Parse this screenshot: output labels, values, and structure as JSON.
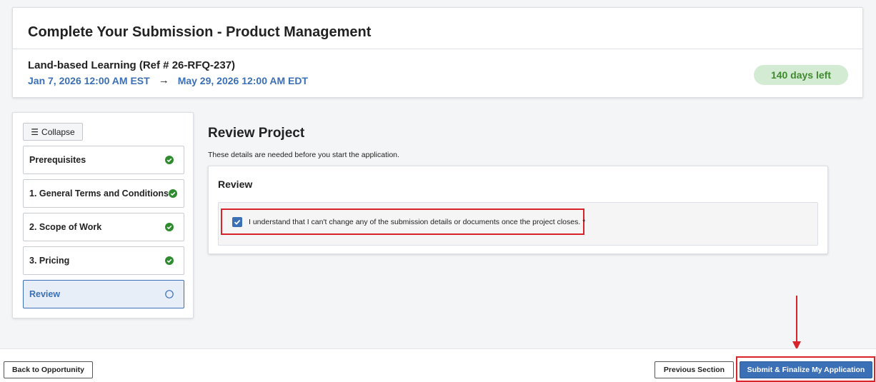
{
  "header": {
    "title": "Complete Your Submission - Product Management",
    "project_name": "Land-based Learning (Ref # 26-RFQ-237)",
    "start_date": "Jan 7, 2026 12:00 AM EST",
    "arrow": "→",
    "end_date": "May 29, 2026 12:00 AM EDT",
    "days_left": "140 days left"
  },
  "sidebar": {
    "collapse_label": "Collapse",
    "collapse_icon": "☰",
    "items": [
      {
        "label": "Prerequisites",
        "status": "complete"
      },
      {
        "label": "1. General Terms and Conditions",
        "status": "complete"
      },
      {
        "label": "2. Scope of Work",
        "status": "complete"
      },
      {
        "label": "3. Pricing",
        "status": "complete"
      },
      {
        "label": "Review",
        "status": "current"
      }
    ]
  },
  "main": {
    "title": "Review Project",
    "description": "These details are needed before you start the application.",
    "review_card": {
      "title": "Review",
      "acknowledgement": "I understand that I can't change any of the submission details or documents once the project closes. *",
      "checked": true
    }
  },
  "footer": {
    "back_label": "Back to Opportunity",
    "previous_label": "Previous Section",
    "submit_label": "Submit & Finalize My Application"
  },
  "colors": {
    "accent": "#3b6fb6",
    "success": "#2e8b2e",
    "badge_bg": "#d4ebd3",
    "annotation": "#d9232b"
  }
}
